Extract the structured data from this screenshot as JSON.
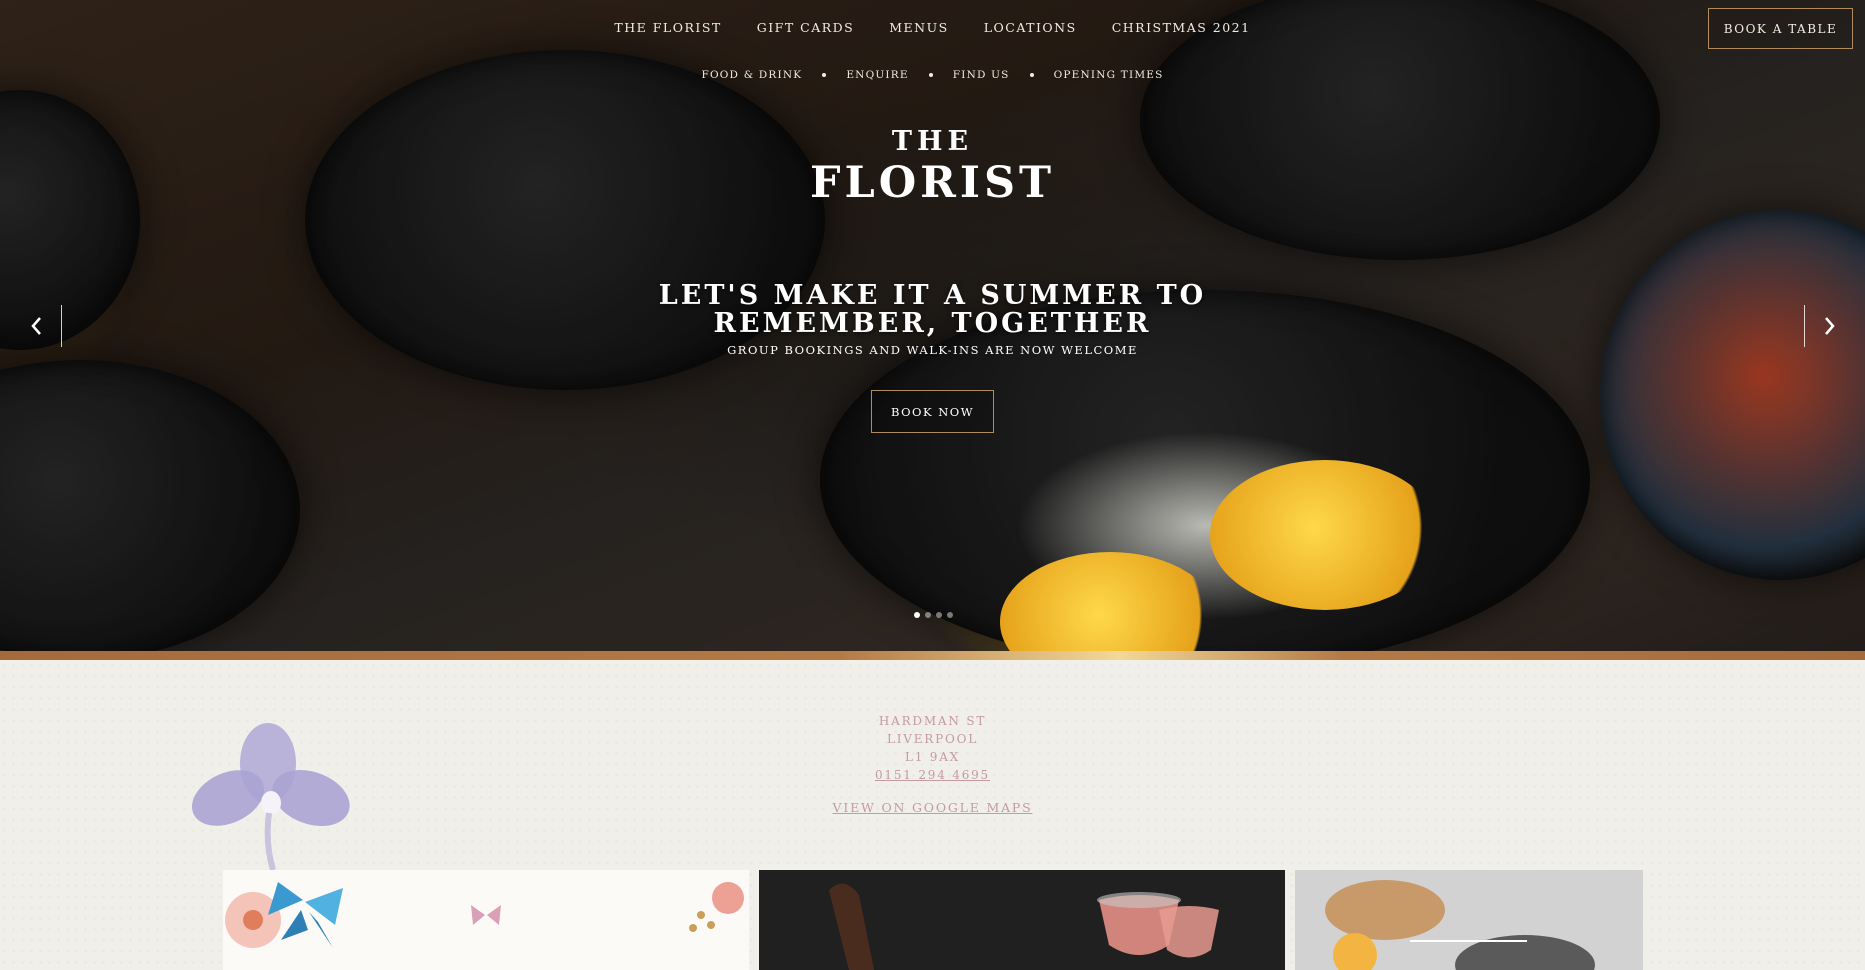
{
  "nav": {
    "primary": [
      "The Florist",
      "Gift Cards",
      "Menus",
      "Locations",
      "Christmas 2021"
    ],
    "secondary": [
      "Food & Drink",
      "Enquire",
      "Find Us",
      "Opening Times"
    ],
    "book_table_label": "Book a Table"
  },
  "logo": {
    "line1": "THE",
    "line2": "FLORIST"
  },
  "hero": {
    "headline_line1": "Let's make it a summer to",
    "headline_line2": "remember, together",
    "subline": "Group bookings and walk-ins are now welcome",
    "cta_label": "Book Now",
    "slide_count": 4,
    "active_slide": 1,
    "prev_icon": "chevron-left-icon",
    "next_icon": "chevron-right-icon"
  },
  "address": {
    "street": "Hardman St",
    "city": "Liverpool",
    "postcode": "L1 9AX",
    "phone": "0151 294 4695",
    "maps_label": "View on Google Maps"
  },
  "colors": {
    "accent_gold": "#b38a5a",
    "address_pink": "#c49aa6",
    "background": "#f1efea"
  }
}
